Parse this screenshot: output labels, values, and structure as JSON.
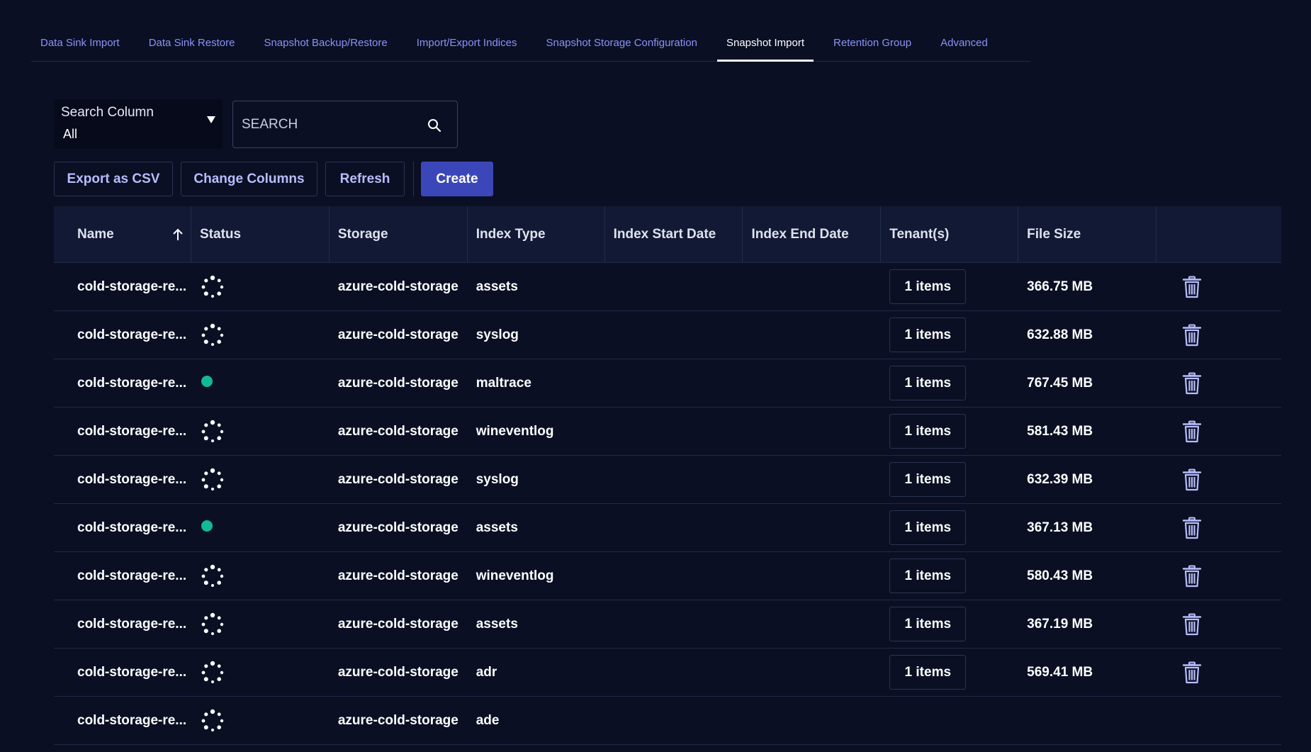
{
  "tabs": [
    {
      "label": "Data Sink Import",
      "active": false
    },
    {
      "label": "Data Sink Restore",
      "active": false
    },
    {
      "label": "Snapshot Backup/Restore",
      "active": false
    },
    {
      "label": "Import/Export Indices",
      "active": false
    },
    {
      "label": "Snapshot Storage Configuration",
      "active": false
    },
    {
      "label": "Snapshot Import",
      "active": true
    },
    {
      "label": "Retention Group",
      "active": false
    },
    {
      "label": "Advanced",
      "active": false
    }
  ],
  "search": {
    "column_label": "Search Column",
    "column_value": "All",
    "placeholder": "SEARCH",
    "value": ""
  },
  "toolbar": {
    "export_label": "Export as CSV",
    "change_columns_label": "Change Columns",
    "refresh_label": "Refresh",
    "create_label": "Create"
  },
  "table": {
    "columns": [
      "Name",
      "Status",
      "Storage",
      "Index Type",
      "Index Start Date",
      "Index End Date",
      "Tenant(s)",
      "File Size",
      ""
    ],
    "sorted_column": "Name",
    "sort_direction": "ascending",
    "rows": [
      {
        "name": "cold-storage-re...",
        "status": "loading",
        "storage": "azure-cold-storage",
        "index_type": "assets",
        "start": "",
        "end": "",
        "tenants": "1 items",
        "size": "366.75 MB",
        "deletable": true
      },
      {
        "name": "cold-storage-re...",
        "status": "loading",
        "storage": "azure-cold-storage",
        "index_type": "syslog",
        "start": "",
        "end": "",
        "tenants": "1 items",
        "size": "632.88 MB",
        "deletable": true
      },
      {
        "name": "cold-storage-re...",
        "status": "ok",
        "storage": "azure-cold-storage",
        "index_type": "maltrace",
        "start": "",
        "end": "",
        "tenants": "1 items",
        "size": "767.45 MB",
        "deletable": true
      },
      {
        "name": "cold-storage-re...",
        "status": "loading",
        "storage": "azure-cold-storage",
        "index_type": "wineventlog",
        "start": "",
        "end": "",
        "tenants": "1 items",
        "size": "581.43 MB",
        "deletable": true
      },
      {
        "name": "cold-storage-re...",
        "status": "loading",
        "storage": "azure-cold-storage",
        "index_type": "syslog",
        "start": "",
        "end": "",
        "tenants": "1 items",
        "size": "632.39 MB",
        "deletable": true
      },
      {
        "name": "cold-storage-re...",
        "status": "ok",
        "storage": "azure-cold-storage",
        "index_type": "assets",
        "start": "",
        "end": "",
        "tenants": "1 items",
        "size": "367.13 MB",
        "deletable": true
      },
      {
        "name": "cold-storage-re...",
        "status": "loading",
        "storage": "azure-cold-storage",
        "index_type": "wineventlog",
        "start": "",
        "end": "",
        "tenants": "1 items",
        "size": "580.43 MB",
        "deletable": true
      },
      {
        "name": "cold-storage-re...",
        "status": "loading",
        "storage": "azure-cold-storage",
        "index_type": "assets",
        "start": "",
        "end": "",
        "tenants": "1 items",
        "size": "367.19 MB",
        "deletable": true
      },
      {
        "name": "cold-storage-re...",
        "status": "loading",
        "storage": "azure-cold-storage",
        "index_type": "adr",
        "start": "",
        "end": "",
        "tenants": "1 items",
        "size": "569.41 MB",
        "deletable": true
      },
      {
        "name": "cold-storage-re...",
        "status": "loading",
        "storage": "azure-cold-storage",
        "index_type": "ade",
        "start": "",
        "end": "",
        "tenants": "",
        "size": "",
        "deletable": false
      }
    ]
  },
  "icons": {
    "search": "search-icon",
    "sort": "arrow-up-icon",
    "loading": "spinner-icon",
    "ok": "status-dot-icon",
    "delete": "trash-icon"
  },
  "colors": {
    "background": "#0a0f24",
    "accent": "#3b47b8",
    "tab_link": "#8a93f5",
    "status_ok": "#12b89a",
    "trash": "#b8bdfb"
  }
}
